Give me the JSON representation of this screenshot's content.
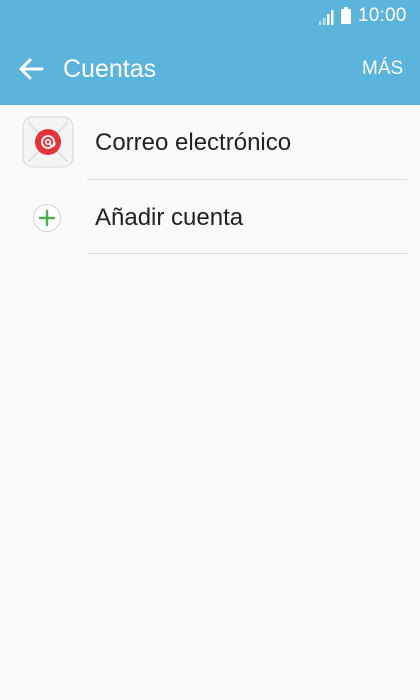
{
  "status_bar": {
    "time": "10:00",
    "icons": [
      "signal-icon",
      "battery-icon"
    ]
  },
  "header": {
    "back_icon": "arrow-left-icon",
    "title": "Cuentas",
    "more_label": "MÁS"
  },
  "accounts": {
    "items": [
      {
        "label": "Correo electrónico",
        "icon": "email-app-icon"
      },
      {
        "label": "Añadir cuenta",
        "icon": "add-icon"
      }
    ]
  },
  "colors": {
    "header_background": "#5bb4dc",
    "page_background": "#fafafa",
    "email_icon_red": "#e5343a",
    "add_icon_green": "#4caf50"
  }
}
